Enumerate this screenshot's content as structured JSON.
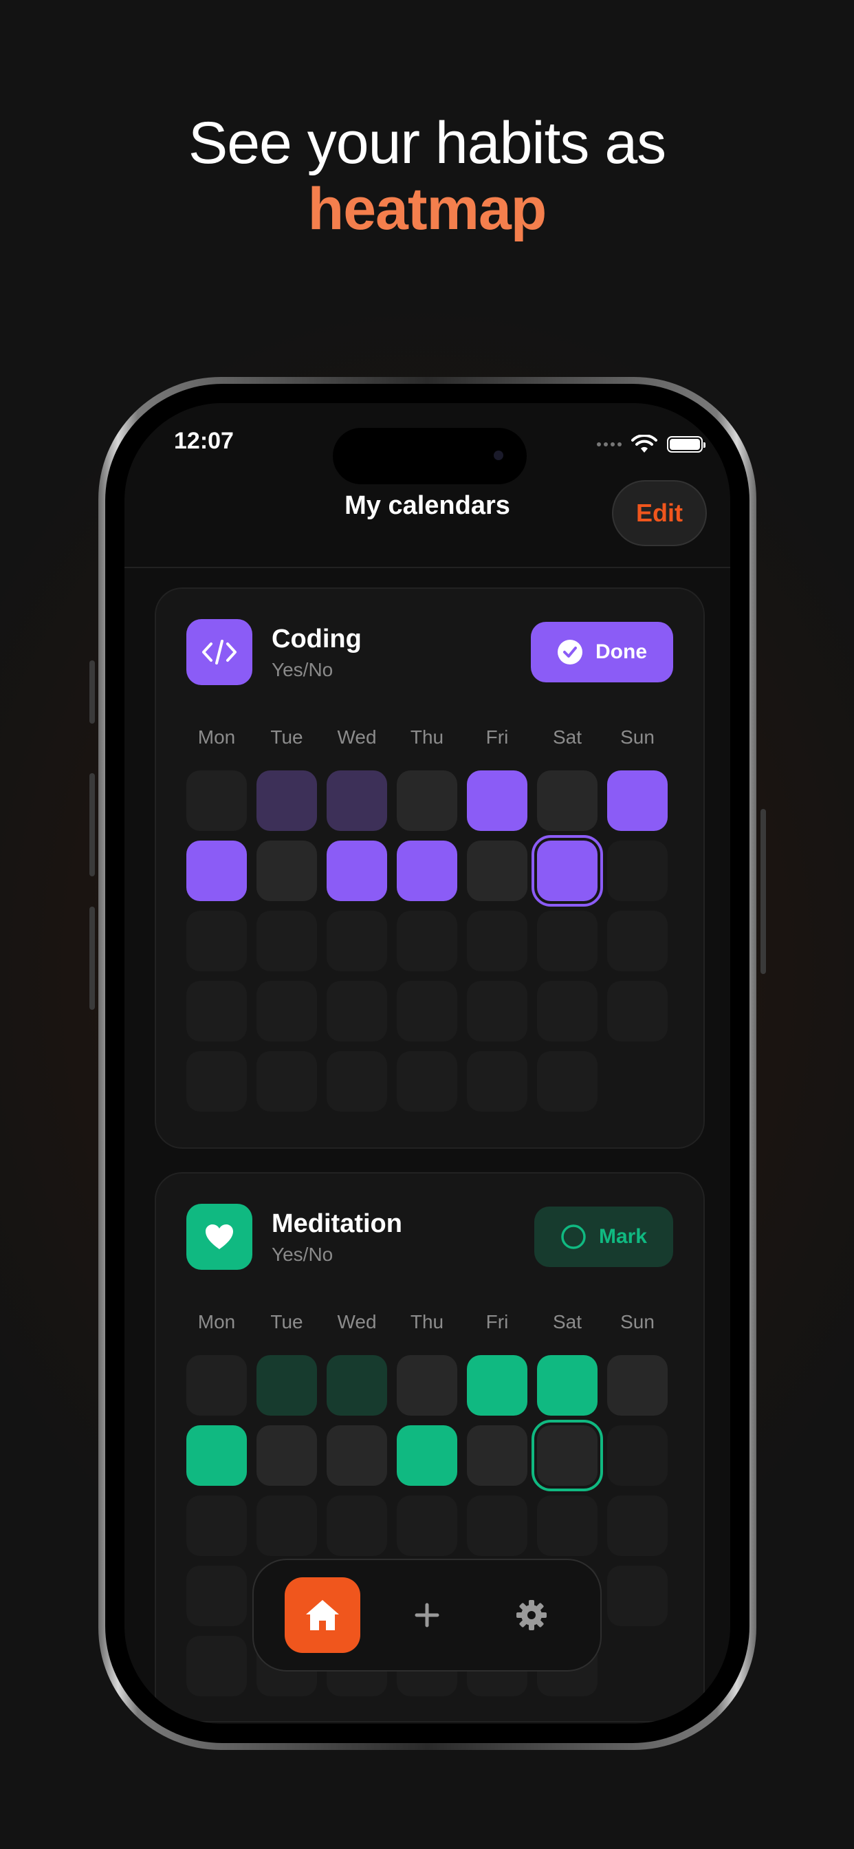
{
  "headline": {
    "line1": "See your habits as",
    "line2": "heatmap"
  },
  "status_bar": {
    "time": "12:07"
  },
  "nav": {
    "title": "My calendars",
    "edit_label": "Edit"
  },
  "weekdays": [
    "Mon",
    "Tue",
    "Wed",
    "Thu",
    "Fri",
    "Sat",
    "Sun"
  ],
  "habits": [
    {
      "name": "Coding",
      "type": "Yes/No",
      "icon": "code-icon",
      "color": "#8b5cf6",
      "action_label": "Done",
      "action_icon": "check-circle-icon"
    },
    {
      "name": "Meditation",
      "type": "Yes/No",
      "icon": "heart-icon",
      "color": "#10b981",
      "action_label": "Mark",
      "action_icon": "empty-circle-icon"
    }
  ],
  "tabbar": {
    "items": [
      "home-icon",
      "plus-icon",
      "gear-icon"
    ],
    "active": "home-icon",
    "accent": "#f0561d"
  }
}
